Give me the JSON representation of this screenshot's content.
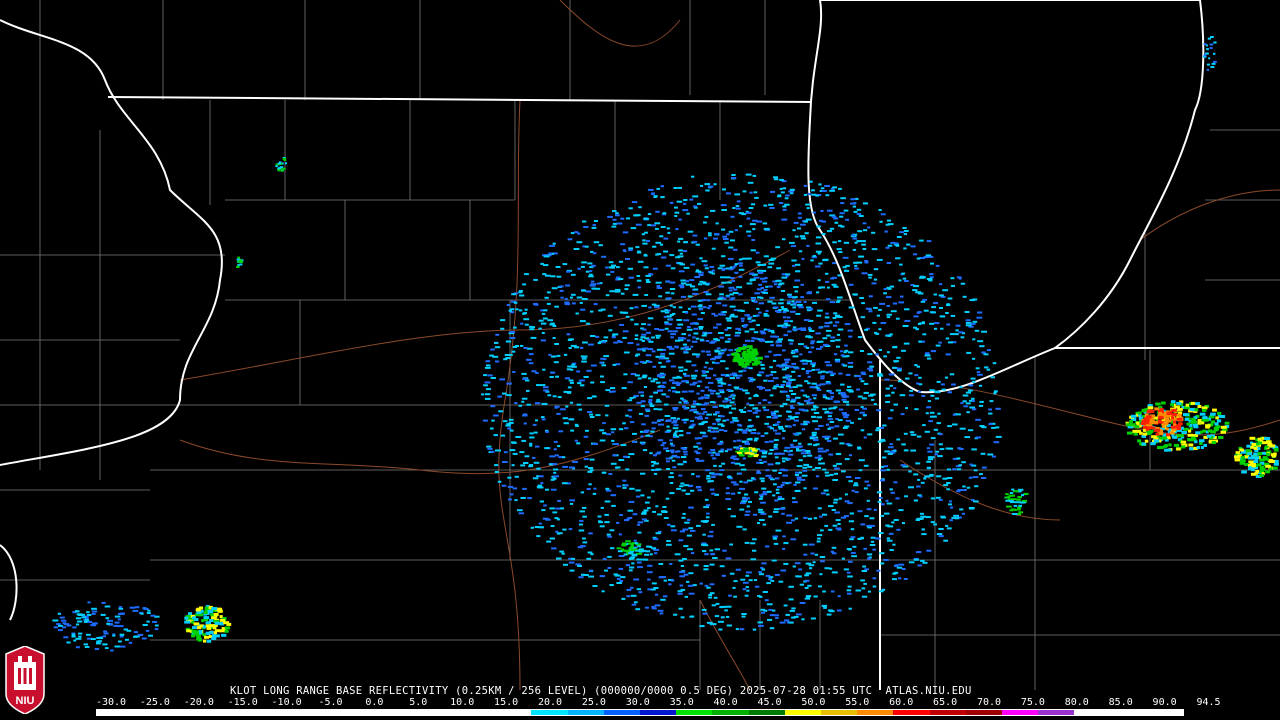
{
  "caption": {
    "text": "KLOT LONG RANGE BASE REFLECTIVITY (0.25KM / 256 LEVEL) (000000/0000 0.5 DEG) 2025-07-28 01:55 UTC  ATLAS.NIU.EDU"
  },
  "legend": {
    "ticks": [
      "-30.0",
      "-25.0",
      "-20.0",
      "-15.0",
      "-10.0",
      "-5.0",
      "0.0",
      "5.0",
      "10.0",
      "15.0",
      "20.0",
      "25.0",
      "30.0",
      "35.0",
      "40.0",
      "45.0",
      "50.0",
      "55.0",
      "60.0",
      "65.0",
      "70.0",
      "75.0",
      "80.0",
      "85.0",
      "90.0",
      "94.5"
    ],
    "colors": [
      "#ffffff",
      "#ffffff",
      "#ffffff",
      "#ffffff",
      "#ffffff",
      "#ffffff",
      "#ffffff",
      "#ffffff",
      "#ffffff",
      "#ffffff",
      "#ffffff",
      "#ffffff",
      "#00e5ff",
      "#00b4ff",
      "#0060ff",
      "#0018d0",
      "#00e000",
      "#00b000",
      "#007a00",
      "#ffff00",
      "#e6c000",
      "#ff8c00",
      "#ff0000",
      "#c00000",
      "#a00000",
      "#ff00ff",
      "#9933cc",
      "#ffffff",
      "#ffffff",
      "#ffffff"
    ]
  },
  "logo": {
    "text": "NIU"
  },
  "colors": {
    "state_line": "#ffffff",
    "county_line": "#8a8a8a",
    "road_line": "#8b4a2b",
    "lake": "#000000",
    "radar_cyan": "#00d0ff",
    "radar_blue": "#1e6cff",
    "radar_green": "#00d000",
    "radar_yellow": "#ffff00",
    "radar_red": "#ff2000"
  }
}
